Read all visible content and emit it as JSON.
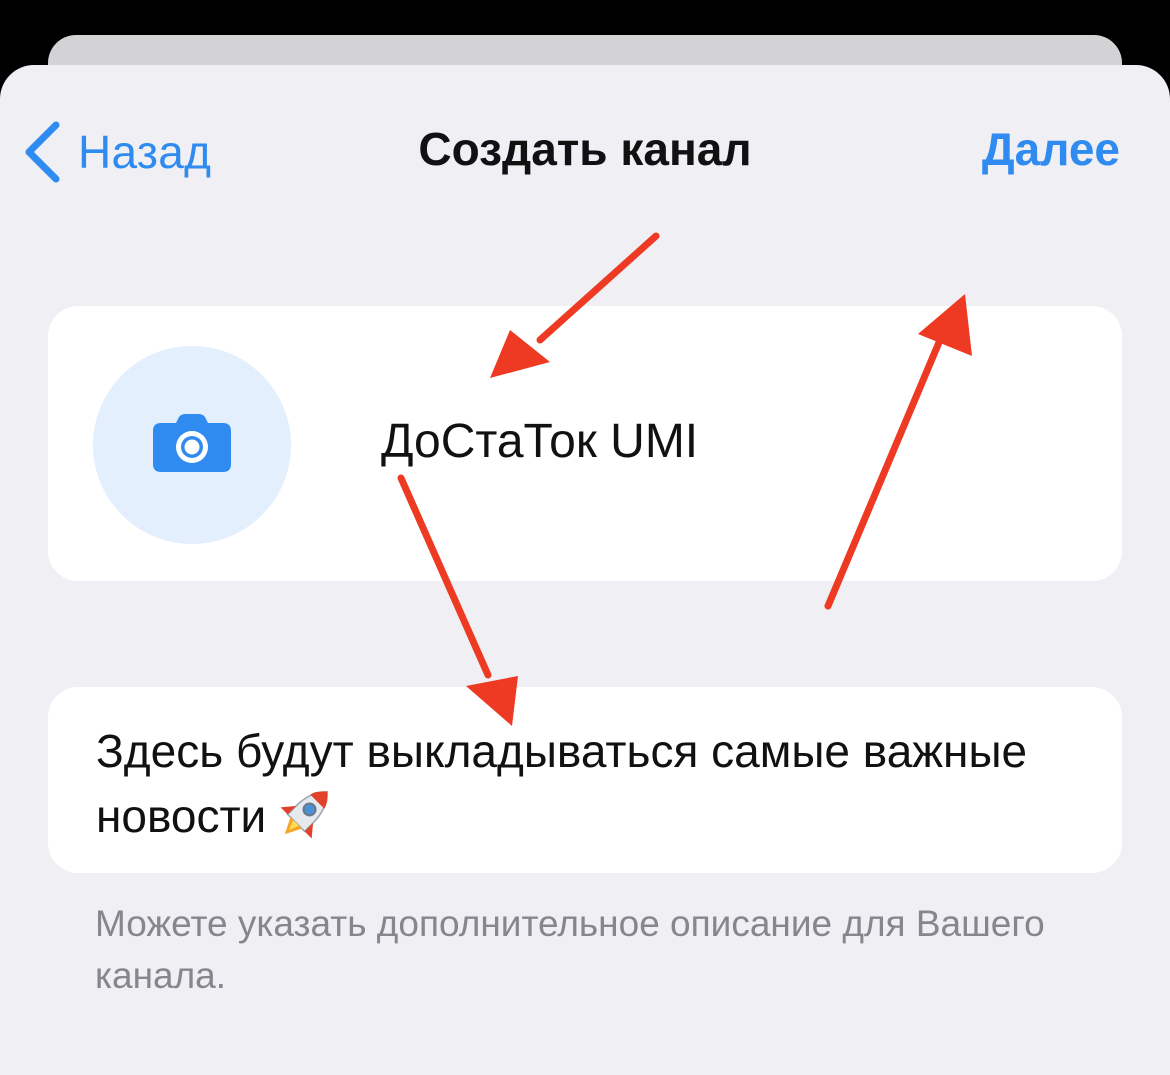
{
  "nav": {
    "back_label": "Назад",
    "title": "Создать канал",
    "next_label": "Далее"
  },
  "channel": {
    "name": "ДоСтаТок UMI",
    "description": "Здесь будут выкладываться самые важные новости",
    "description_hint": "Можете указать дополнительное описание для Вашего канала."
  },
  "icons": {
    "back": "chevron-left-icon",
    "avatar": "camera-icon",
    "description_emoji": "rocket-emoji",
    "annotation": "red-arrow"
  },
  "colors": {
    "accent": "#2f8bf0",
    "background": "#efeff4",
    "card": "#ffffff",
    "avatar_bg": "#e3effc",
    "hint": "#86868c",
    "annotation_arrow": "#ee3a22"
  }
}
